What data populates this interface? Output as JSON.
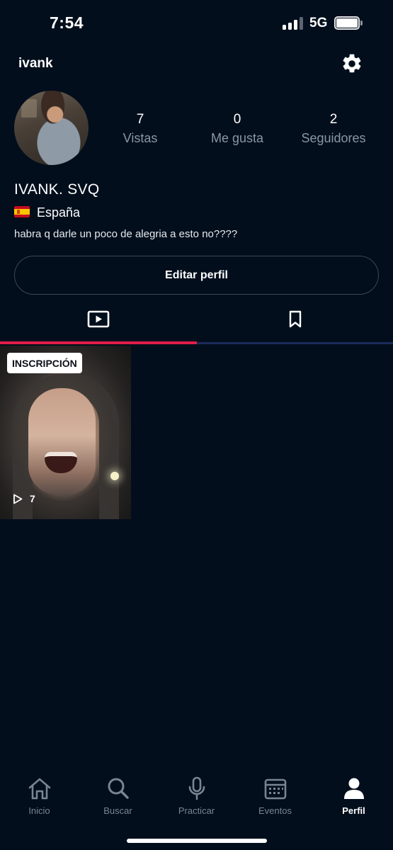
{
  "status_bar": {
    "time": "7:54",
    "network": "5G",
    "signal_bars_active": 3,
    "signal_bars_total": 4
  },
  "header": {
    "username": "ivank",
    "settings_icon": "gear-icon"
  },
  "profile": {
    "stats": [
      {
        "value": "7",
        "label": "Vistas"
      },
      {
        "value": "0",
        "label": "Me gusta"
      },
      {
        "value": "2",
        "label": "Seguidores"
      }
    ],
    "display_name": "IVANK. SVQ",
    "country": "España",
    "flag_icon": "spain-flag-icon",
    "bio": "habra q darle un poco de alegria a esto no????",
    "edit_label": "Editar perfil"
  },
  "tabs": [
    {
      "icon": "play-box-icon",
      "active": true
    },
    {
      "icon": "bookmark-icon",
      "active": false
    }
  ],
  "videos": [
    {
      "badge": "INSCRIPCIÓN",
      "views": "7"
    }
  ],
  "bottom_nav": [
    {
      "label": "Inicio",
      "icon": "home-icon",
      "active": false
    },
    {
      "label": "Buscar",
      "icon": "search-icon",
      "active": false
    },
    {
      "label": "Practicar",
      "icon": "microphone-icon",
      "active": false
    },
    {
      "label": "Eventos",
      "icon": "calendar-icon",
      "active": false
    },
    {
      "label": "Perfil",
      "icon": "person-icon",
      "active": true
    }
  ],
  "colors": {
    "background": "#020e1c",
    "accent": "#e11d48",
    "muted_text": "#8c96a4"
  }
}
